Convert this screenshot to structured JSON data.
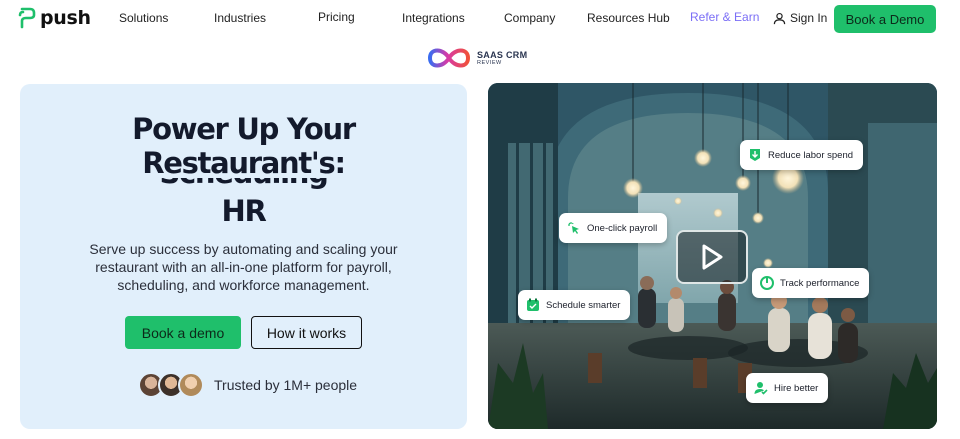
{
  "nav": {
    "logo_text": "push",
    "items": [
      "Solutions",
      "Industries",
      "Pricing",
      "Integrations",
      "Company",
      "Resources Hub",
      "Refer & Earn"
    ],
    "signin": "Sign In",
    "demo_button": "Book a Demo"
  },
  "badge": {
    "title": "SAAS CRM",
    "subtitle": "REVIEW"
  },
  "hero": {
    "headline_line1": "Power Up Your",
    "headline_line2": "Restaurant's:",
    "headline_rotating_ghost": "Scheduling",
    "headline_line3": "HR",
    "subcopy": "Serve up success by automating and scaling your restaurant with an all-in-one platform for payroll, scheduling, and workforce management.",
    "book_button": "Book a demo",
    "how_button": "How it works",
    "trust_text": "Trusted by 1M+ people"
  },
  "callouts": {
    "labor": "Reduce labor spend",
    "payroll": "One-click payroll",
    "performance": "Track performance",
    "schedule": "Schedule smarter",
    "hire": "Hire better"
  },
  "colors": {
    "accent_green": "#1fbf6b",
    "hero_bg": "#e1effb",
    "refer_purple": "#7b6ef6"
  }
}
